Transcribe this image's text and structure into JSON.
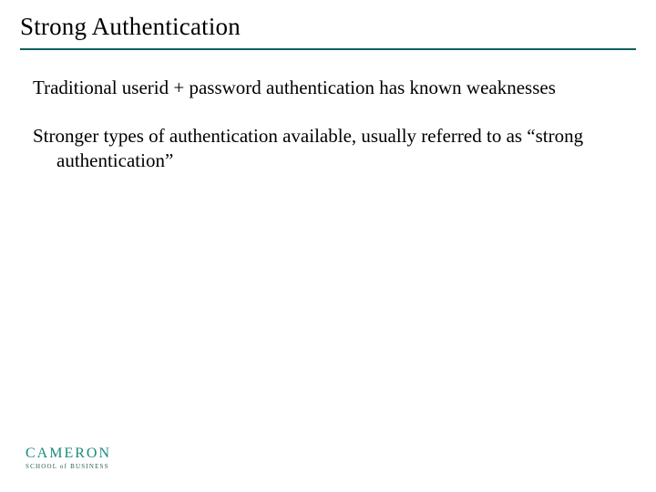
{
  "title": "Strong Authentication",
  "paragraphs": [
    "Traditional userid + password authentication has known weaknesses",
    "Stronger types of authentication available, usually referred to as “strong authentication”"
  ],
  "logo": {
    "main": "CAMERON",
    "sub": "SCHOOL of BUSINESS"
  },
  "accent_color": "#0e5f5f"
}
